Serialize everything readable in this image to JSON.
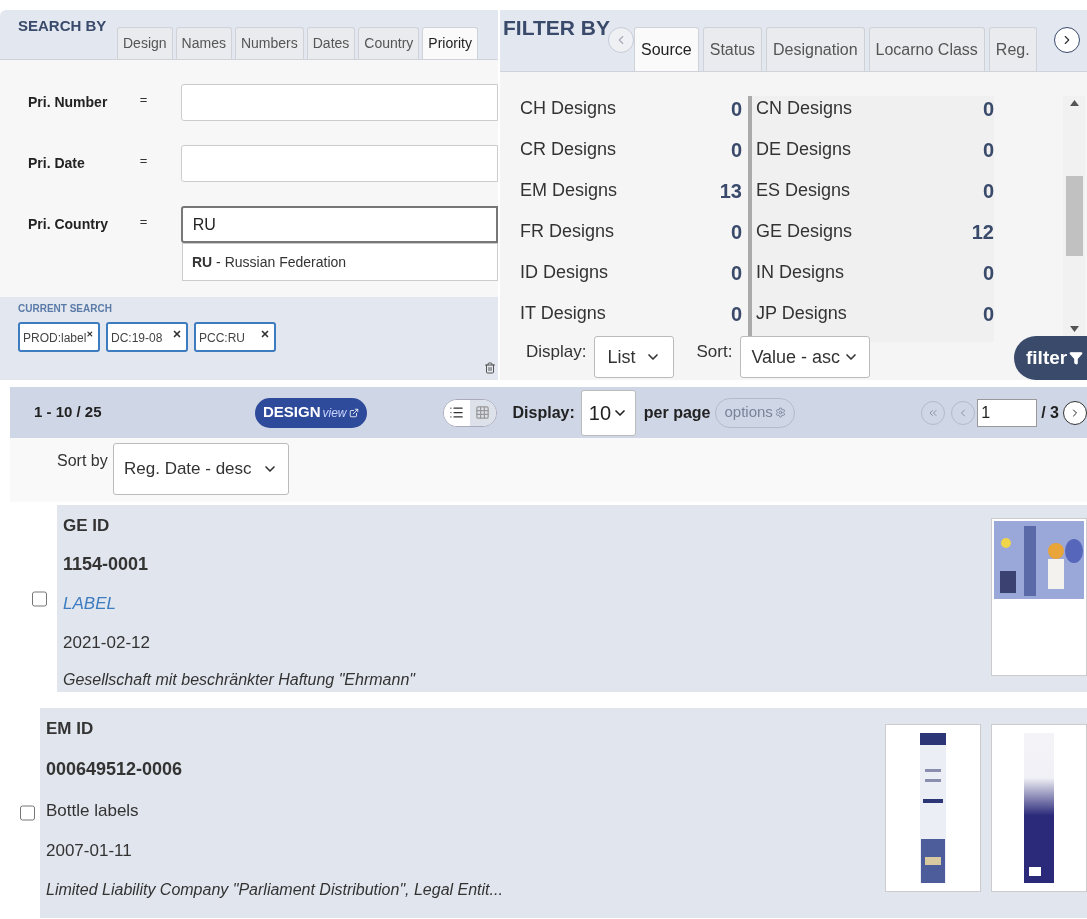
{
  "search": {
    "title": "SEARCH BY",
    "tabs": [
      {
        "label": "Design",
        "selected": false
      },
      {
        "label": "Names",
        "selected": false
      },
      {
        "label": "Numbers",
        "selected": false
      },
      {
        "label": "Dates",
        "selected": false
      },
      {
        "label": "Country",
        "selected": false
      },
      {
        "label": "Priority",
        "selected": true
      }
    ],
    "fields": [
      {
        "label": "Pri. Number",
        "operator": "=",
        "focused": false
      },
      {
        "label": "Pri. Date",
        "operator": "=",
        "focused": false
      },
      {
        "label": "Pri. Country",
        "operator": "=",
        "value": "RU",
        "focused": true
      }
    ],
    "suggestion": "**RU** - Russian Federation",
    "current_search": {
      "title": "CURRENT SEARCH",
      "tags": [
        "PROD:label",
        "DC:19-08",
        "PCC:RU"
      ]
    }
  },
  "filter": {
    "title": "FILTER BY",
    "tabs": [
      {
        "label": "Source",
        "selected": true
      },
      {
        "label": "Status",
        "selected": false
      },
      {
        "label": "Designation",
        "selected": false
      },
      {
        "label": "Locarno Class",
        "selected": false
      },
      {
        "label": "Reg.",
        "selected": false
      }
    ],
    "rows": [
      {
        "left": {
          "label": "CH Designs",
          "count": "0"
        },
        "right": {
          "label": "CN Designs",
          "count": "0"
        }
      },
      {
        "left": {
          "label": "CR Designs",
          "count": "0"
        },
        "right": {
          "label": "DE Designs",
          "count": "0"
        }
      },
      {
        "left": {
          "label": "EM Designs",
          "count": "13"
        },
        "right": {
          "label": "ES Designs",
          "count": "0"
        }
      },
      {
        "left": {
          "label": "FR Designs",
          "count": "0"
        },
        "right": {
          "label": "GE Designs",
          "count": "12"
        }
      },
      {
        "left": {
          "label": "ID Designs",
          "count": "0"
        },
        "right": {
          "label": "IN Designs",
          "count": "0"
        }
      },
      {
        "left": {
          "label": "IT Designs",
          "count": "0"
        },
        "right": {
          "label": "JP Designs",
          "count": "0"
        }
      }
    ],
    "display": {
      "label": "Display:",
      "value": "List"
    },
    "sort": {
      "label": "Sort:",
      "value": "Value - asc"
    },
    "button": "filter"
  },
  "toolbar": {
    "range": "1 - 10 / 25",
    "design_view": {
      "brand": "DESIGN",
      "suffix": "view"
    },
    "view_modes": [
      {
        "kind": "list",
        "selected": true
      },
      {
        "kind": "grid",
        "selected": false
      }
    ],
    "display_label": "Display:",
    "per_page": "10",
    "per_page_label": "per page",
    "options": "options",
    "page": "1",
    "page_total": "/ 3"
  },
  "sort": {
    "label": "Sort by",
    "value": "Reg. Date - desc"
  },
  "results": [
    {
      "id_label": "GE ID",
      "number": "1154-0001",
      "indication": "LABEL",
      "linked": true,
      "date": "2021-02-12",
      "owner": "Gesellschaft mit beschränkter Haftung \"Ehrmann\"",
      "checked": false
    },
    {
      "id_label": "EM ID",
      "number": "000649512-0006",
      "indication": "Bottle labels",
      "linked": false,
      "date": "2007-01-11",
      "owner": "Limited Liability Company \"Parliament Distribution\", Legal Entit...",
      "checked": false
    }
  ]
}
